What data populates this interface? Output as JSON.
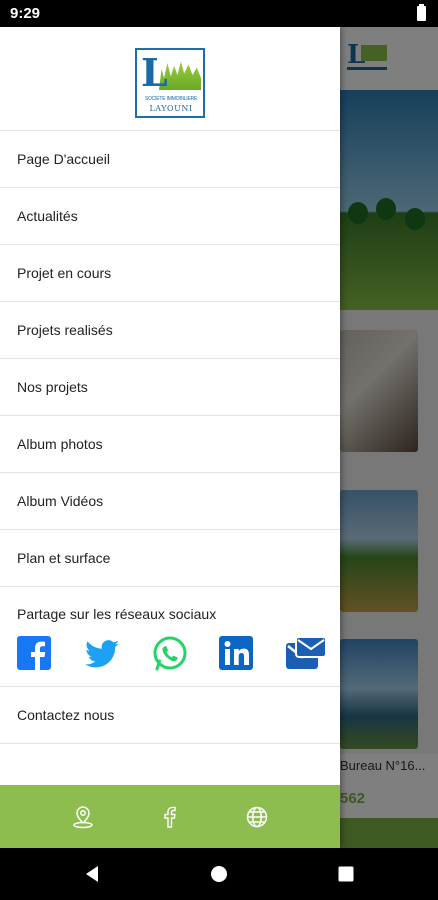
{
  "status_bar": {
    "time": "9:29"
  },
  "logo": {
    "letter": "L",
    "tagline": "SOCIETE IMMOBILIERE",
    "name": "LAYOUNI"
  },
  "menu": {
    "items": [
      {
        "label": "Page D'accueil"
      },
      {
        "label": "Actualités"
      },
      {
        "label": "Projet en cours"
      },
      {
        "label": "Projets realisés"
      },
      {
        "label": "Nos projets"
      },
      {
        "label": "Album photos"
      },
      {
        "label": "Album Vidéos"
      },
      {
        "label": "Plan et surface"
      }
    ],
    "share_label": "Partage sur les réseaux sociaux",
    "share_icons": [
      "facebook-icon",
      "twitter-icon",
      "whatsapp-icon",
      "linkedin-icon",
      "email-icon"
    ],
    "contact_label": "Contactez nous"
  },
  "footer": {
    "icons": [
      "location-icon",
      "facebook-icon",
      "globe-icon"
    ]
  },
  "background": {
    "card_title": "Bureau N°16...",
    "card_price": "562"
  },
  "colors": {
    "accent": "#8dbd4e",
    "brand_blue": "#1b6aa5",
    "facebook": "#1877f2",
    "twitter": "#1da1f2",
    "whatsapp": "#25d366",
    "linkedin": "#0a66c2",
    "email": "#1a5fb4"
  }
}
